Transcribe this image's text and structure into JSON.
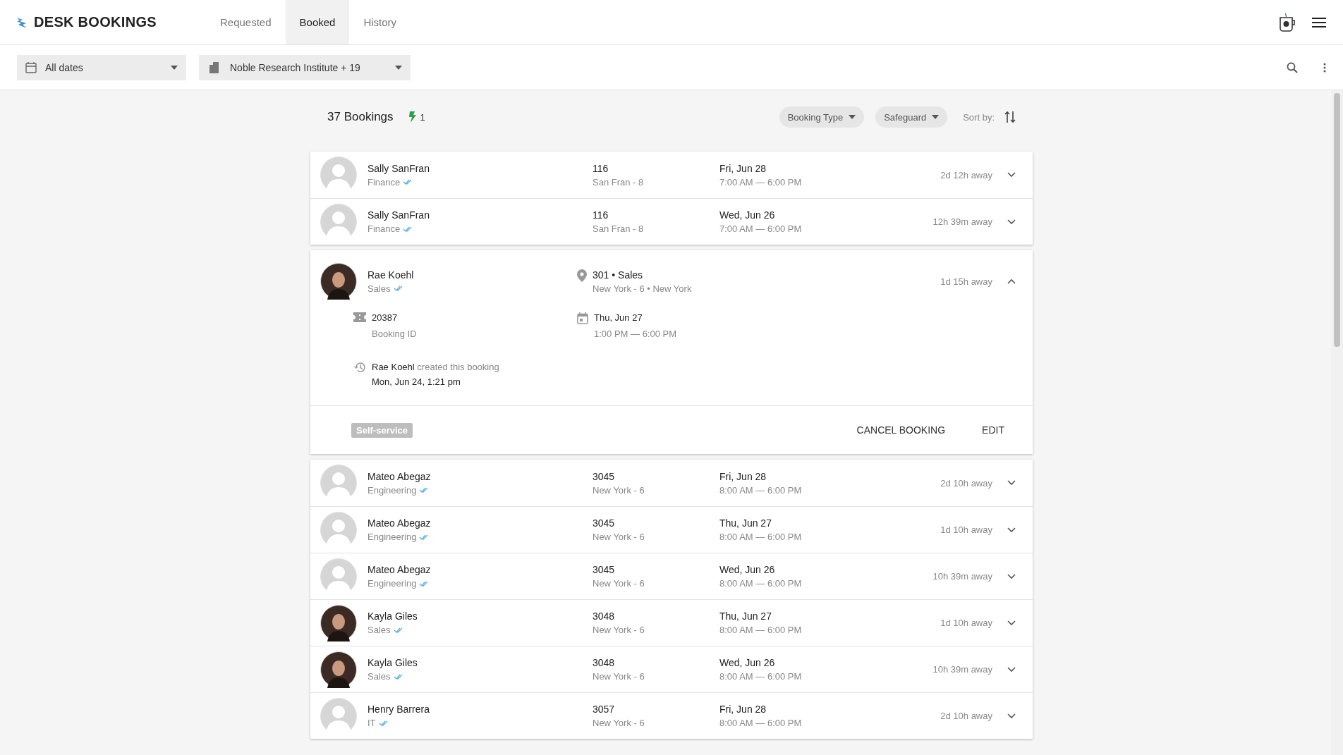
{
  "app": {
    "title": "DESK BOOKINGS"
  },
  "tabs": [
    {
      "label": "Requested",
      "selected": false
    },
    {
      "label": "Booked",
      "selected": true
    },
    {
      "label": "History",
      "selected": false
    }
  ],
  "filters": [
    {
      "kind": "date",
      "label": "All dates"
    },
    {
      "kind": "building",
      "label": "Noble Research Institute + 19"
    }
  ],
  "summary": {
    "count": "37 Bookings",
    "flash_count": "1",
    "chips": [
      "Booking Type",
      "Safeguard"
    ],
    "sort_label": "Sort by:"
  },
  "bookings": [
    {
      "name": "Sally SanFran",
      "department": "Finance",
      "kind": "placeholder",
      "desk": "116",
      "location": "San Fran - 8",
      "date": "Fri, Jun 28",
      "time": "7:00 AM — 6:00 PM",
      "away": "2d 12h away",
      "expanded": false
    },
    {
      "name": "Sally SanFran",
      "department": "Finance",
      "kind": "placeholder",
      "desk": "116",
      "location": "San Fran - 8",
      "date": "Wed, Jun 26",
      "time": "7:00 AM — 6:00 PM",
      "away": "12h 39m away",
      "expanded": false
    },
    {
      "name": "Rae Koehl",
      "department": "Sales",
      "kind": "photo",
      "desk": "301 • Sales",
      "location": "New York - 6 • New York",
      "date": "Thu, Jun 27",
      "time": "1:00 PM — 6:00 PM",
      "away": "1d 15h away",
      "expanded": true,
      "booking_id": "20387",
      "booking_id_label": "Booking ID",
      "created_by": "Rae Koehl",
      "created_text": "created this booking",
      "created_at": "Mon, Jun 24, 1:21 pm",
      "tag": "Self-service",
      "actions": [
        "CANCEL BOOKING",
        "EDIT"
      ]
    },
    {
      "name": "Mateo Abegaz",
      "department": "Engineering",
      "kind": "placeholder",
      "desk": "3045",
      "location": "New York - 6",
      "date": "Fri, Jun 28",
      "time": "8:00 AM — 6:00 PM",
      "away": "2d 10h away",
      "expanded": false
    },
    {
      "name": "Mateo Abegaz",
      "department": "Engineering",
      "kind": "placeholder",
      "desk": "3045",
      "location": "New York - 6",
      "date": "Thu, Jun 27",
      "time": "8:00 AM — 6:00 PM",
      "away": "1d 10h away",
      "expanded": false
    },
    {
      "name": "Mateo Abegaz",
      "department": "Engineering",
      "kind": "placeholder",
      "desk": "3045",
      "location": "New York - 6",
      "date": "Wed, Jun 26",
      "time": "8:00 AM — 6:00 PM",
      "away": "10h 39m away",
      "expanded": false
    },
    {
      "name": "Kayla Giles",
      "department": "Sales",
      "kind": "photo",
      "desk": "3048",
      "location": "New York - 6",
      "date": "Thu, Jun 27",
      "time": "8:00 AM — 6:00 PM",
      "away": "1d 10h away",
      "expanded": false
    },
    {
      "name": "Kayla Giles",
      "department": "Sales",
      "kind": "photo",
      "desk": "3048",
      "location": "New York - 6",
      "date": "Wed, Jun 26",
      "time": "8:00 AM — 6:00 PM",
      "away": "10h 39m away",
      "expanded": false
    },
    {
      "name": "Henry Barrera",
      "department": "IT",
      "kind": "placeholder",
      "desk": "3057",
      "location": "New York - 6",
      "date": "Fri, Jun 28",
      "time": "8:00 AM — 6:00 PM",
      "away": "2d 10h away",
      "expanded": false
    }
  ]
}
